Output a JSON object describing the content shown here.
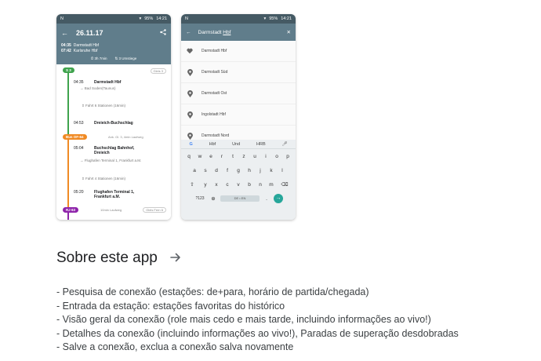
{
  "screenshot1": {
    "status_left": "N",
    "status_right": "95%",
    "time": "14:21",
    "date": "26.11.17",
    "departure_time": "04:35",
    "departure_station": "Darmstadt Hbf",
    "arrival_time": "07:42",
    "arrival_station": "Karlsruhe Hbf",
    "duration": "3h 7min",
    "transfers": "3 Umstiege",
    "badges": {
      "s3": "S 3",
      "bus": "Bus OF-64",
      "rj": "RJ 63"
    },
    "pill1": "Gleis 3",
    "pill2": "Gleis Fern 6",
    "stops": [
      {
        "time": "04:35",
        "name": "Darmstadt Hbf"
      },
      {
        "time": "04:53",
        "name": "Dreieich-Buchschlag"
      },
      {
        "time": "05:04",
        "name": "Buchschlag Bahnhof, Dreieich"
      },
      {
        "time": "05:20",
        "name": "Flughafen Terminal 1, Frankfurt a.M."
      }
    ],
    "notes": {
      "dir1": "→ Bad Soden(Taunus)",
      "seg1": "Fahrt 6 Stationen (16min)",
      "walk1": "Ank. Gl. 3, 4min Laufweg",
      "dir2": "→ Flughafen Terminal 1, Frankfurt a.M.",
      "seg2": "Fahrt 4 Stationen (16min)",
      "walk2": "10min Laufweg"
    }
  },
  "screenshot2": {
    "status_left": "N",
    "status_right": "95%",
    "time": "14:21",
    "query_prefix": "Darmstadt ",
    "query_typed": "Hbf",
    "suggestions": [
      {
        "icon": "heart-icon",
        "label": "Darmstadt Hbf"
      },
      {
        "icon": "place-icon",
        "label": "Darmstadt Süd"
      },
      {
        "icon": "place-icon",
        "label": "Darmstadt Ost"
      },
      {
        "icon": "place-icon",
        "label": "Ingolstadt Hbf"
      },
      {
        "icon": "place-icon",
        "label": "Darmstadt Nord"
      }
    ],
    "keyboard": {
      "suggestions": [
        "Hbf",
        "Und",
        "HRB"
      ],
      "row1": [
        "q",
        "w",
        "e",
        "r",
        "t",
        "z",
        "u",
        "i",
        "o",
        "p"
      ],
      "row2": [
        "a",
        "s",
        "d",
        "f",
        "g",
        "h",
        "j",
        "k",
        "l"
      ],
      "row3": [
        "y",
        "x",
        "c",
        "v",
        "b",
        "n",
        "m"
      ],
      "num_key": "?123",
      "space_label": "DE • EN"
    }
  },
  "about": {
    "title": "Sobre este app",
    "lines": [
      "- Pesquisa de conexão (estações: de+para, horário de partida/chegada)",
      "- Entrada da estação: estações favoritas do histórico",
      "- Visão geral da conexão (role mais cedo e mais tarde, incluindo informações ao vivo!)",
      "- Detalhes da conexão (incluindo informações ao vivo!), Paradas de superação desdobradas",
      "- Salve a conexão, exclua a conexão salva novamente"
    ]
  },
  "colors": {
    "header": "#607d8b",
    "s_bahn": "#3fa34d",
    "bus": "#f08a24",
    "rj": "#8e24aa"
  }
}
